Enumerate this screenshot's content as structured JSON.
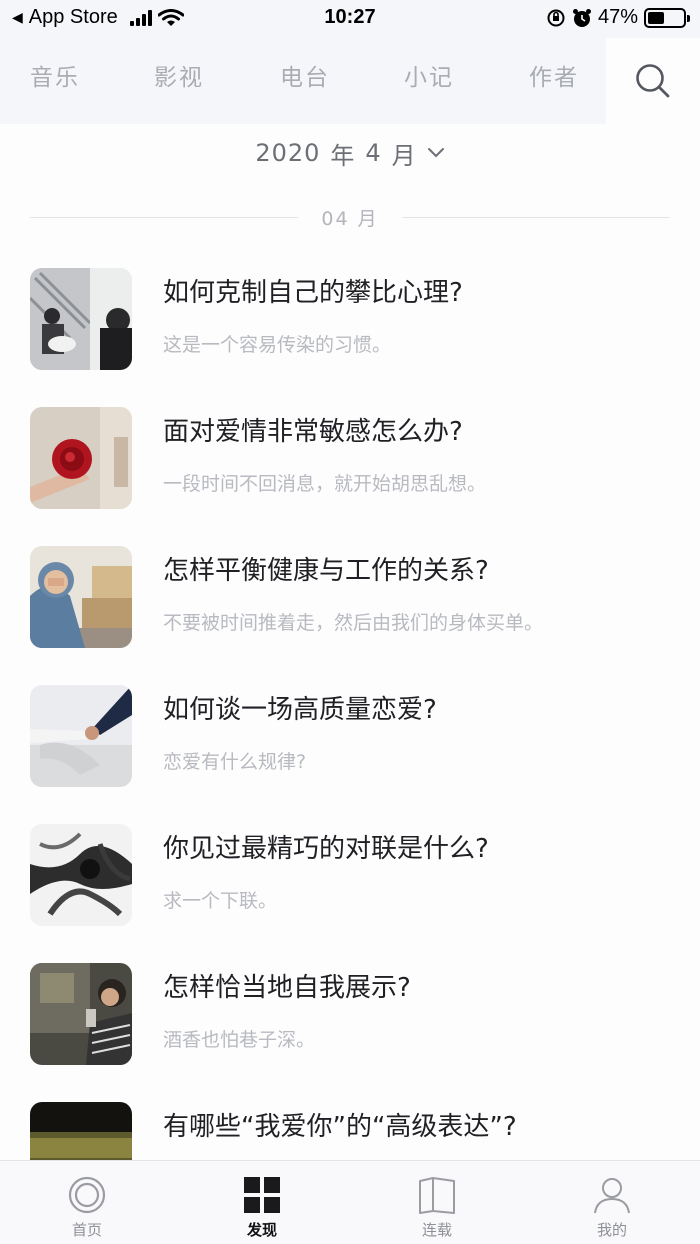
{
  "status_bar": {
    "back_app": "App Store",
    "time": "10:27",
    "battery_text": "47%",
    "battery_level": 0.47
  },
  "category_tabs": [
    "音乐",
    "影视",
    "电台",
    "小记",
    "作者"
  ],
  "month_selector": {
    "year": "2020",
    "year_unit": "年",
    "month": "4",
    "month_unit": "月"
  },
  "divider_label": "04 月",
  "articles": [
    {
      "title": "如何克制自己的攀比心理?",
      "summary": "这是一个容易传染的习惯。"
    },
    {
      "title": "面对爱情非常敏感怎么办?",
      "summary": "一段时间不回消息，就开始胡思乱想。"
    },
    {
      "title": "怎样平衡健康与工作的关系?",
      "summary": "不要被时间推着走，然后由我们的身体买单。"
    },
    {
      "title": "如何谈一场高质量恋爱?",
      "summary": "恋爱有什么规律?"
    },
    {
      "title": "你见过最精巧的对联是什么?",
      "summary": "求一个下联。"
    },
    {
      "title": "怎样恰当地自我展示?",
      "summary": "酒香也怕巷子深。"
    },
    {
      "title": "有哪些“我爱你”的“高级表达”?",
      "summary": ""
    }
  ],
  "tab_bar": {
    "items": [
      {
        "label": "首页",
        "icon": "home-ring-icon"
      },
      {
        "label": "发现",
        "icon": "grid-icon"
      },
      {
        "label": "连载",
        "icon": "book-icon"
      },
      {
        "label": "我的",
        "icon": "person-icon"
      }
    ],
    "active_index": 1
  },
  "colors": {
    "nav_bg": "#f5f6f9",
    "tab_inactive": "#a9acb3",
    "title": "#1f1f24",
    "summary": "#b8bac0"
  }
}
